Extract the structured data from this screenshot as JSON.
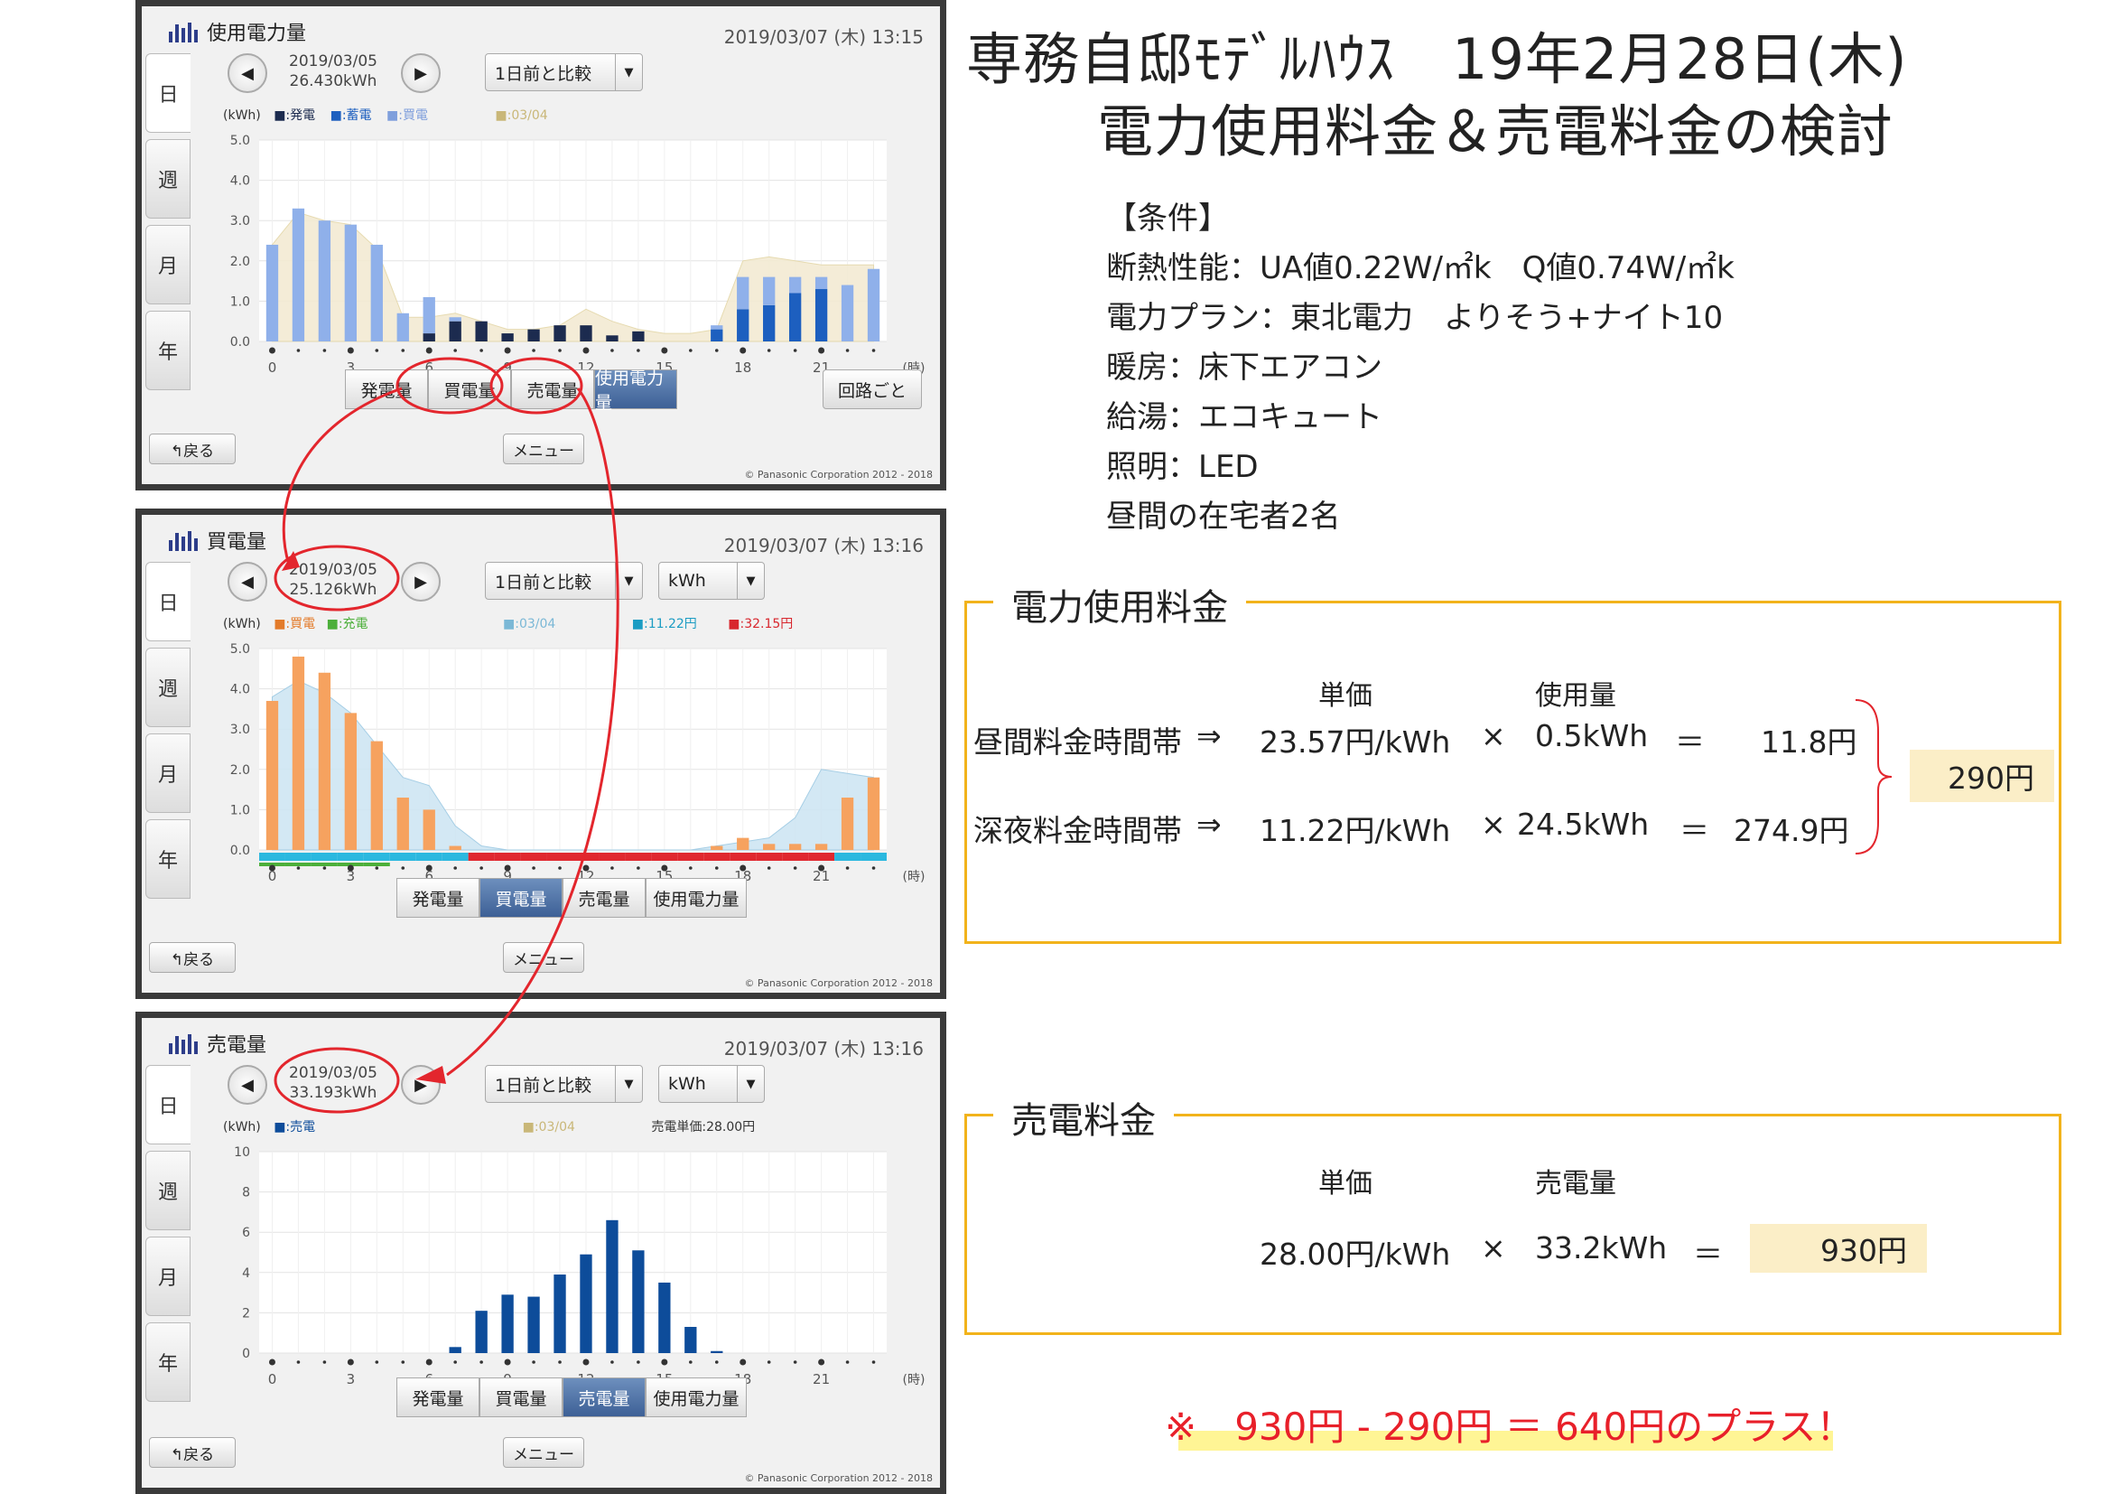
{
  "panels": [
    {
      "title": "使用電力量",
      "timestamp": "2019/03/07 (木) 13:15",
      "date": "2019/03/05",
      "amount": "26.430kWh",
      "compare": "1日前と比較",
      "unit": "",
      "tabs": [
        "日",
        "週",
        "月",
        "年"
      ],
      "legend": [
        "■:発電",
        "■:蓄電",
        "■:買電",
        "■:03/04"
      ],
      "buttons": [
        "発電量",
        "買電量",
        "売電量",
        "使用電力量"
      ],
      "active_button": 3,
      "circuit": "回路ごと",
      "back": "↰戻る",
      "menu": "メニュー",
      "copyright": "© Panasonic Corporation 2012 - 2018"
    },
    {
      "title": "買電量",
      "timestamp": "2019/03/07 (木) 13:16",
      "date": "2019/03/05",
      "amount": "25.126kWh",
      "compare": "1日前と比較",
      "unit": "kWh",
      "tabs": [
        "日",
        "週",
        "月",
        "年"
      ],
      "legend": [
        "■:買電",
        "■:充電",
        "■:03/04",
        "■:11.22円",
        "■:32.15円"
      ],
      "buttons": [
        "発電量",
        "買電量",
        "売電量",
        "使用電力量"
      ],
      "active_button": 1,
      "back": "↰戻る",
      "menu": "メニュー",
      "copyright": "© Panasonic Corporation 2012 - 2018"
    },
    {
      "title": "売電量",
      "timestamp": "2019/03/07 (木) 13:16",
      "date": "2019/03/05",
      "amount": "33.193kWh",
      "compare": "1日前と比較",
      "unit": "kWh",
      "tabs": [
        "日",
        "週",
        "月",
        "年"
      ],
      "legend": [
        "■:売電",
        "■:03/04",
        "売電単価:28.00円"
      ],
      "buttons": [
        "発電量",
        "買電量",
        "売電量",
        "使用電力量"
      ],
      "active_button": 2,
      "back": "↰戻る",
      "menu": "メニュー",
      "copyright": "© Panasonic Corporation 2012 - 2018"
    }
  ],
  "chart_data": [
    {
      "type": "bar",
      "ylabel": "(kWh)",
      "xlabel": "(時)",
      "ylim": [
        0,
        5
      ],
      "yticks": [
        "0.0",
        "1.0",
        "2.0",
        "3.0",
        "4.0",
        "5.0"
      ],
      "xticks": [
        "0",
        "3",
        "6",
        "9",
        "12",
        "15",
        "18",
        "21"
      ],
      "categories": [
        "0",
        "1",
        "2",
        "3",
        "4",
        "5",
        "6",
        "7",
        "8",
        "9",
        "10",
        "11",
        "12",
        "13",
        "14",
        "15",
        "16",
        "17",
        "18",
        "19",
        "20",
        "21",
        "22",
        "23"
      ],
      "series": [
        {
          "name": "発電",
          "color": "#1c2b4f",
          "values": [
            0,
            0,
            0,
            0,
            0,
            0,
            0.2,
            0.5,
            0.5,
            0.2,
            0.3,
            0.4,
            0.4,
            0.15,
            0.25,
            0,
            0,
            0,
            0,
            0,
            0,
            0,
            0,
            0
          ]
        },
        {
          "name": "蓄電",
          "color": "#1d5fbf",
          "values": [
            0,
            0,
            0,
            0,
            0,
            0,
            0,
            0,
            0,
            0,
            0,
            0,
            0,
            0,
            0,
            0,
            0,
            0.3,
            0.8,
            0.9,
            1.2,
            1.3,
            0,
            0
          ]
        },
        {
          "name": "買電",
          "color": "#8fb0ea",
          "values": [
            2.4,
            3.3,
            3.0,
            2.9,
            2.4,
            0.7,
            0.9,
            0.1,
            0,
            0,
            0,
            0,
            0,
            0,
            0,
            0,
            0,
            0.1,
            0.8,
            0.7,
            0.4,
            0.3,
            1.4,
            1.8
          ]
        },
        {
          "name": "03/04",
          "color": "#f3ebd3",
          "values": [
            2.4,
            3.2,
            3.0,
            2.9,
            2.3,
            0.6,
            0.6,
            0.7,
            0.5,
            0.3,
            0.3,
            0.4,
            0.8,
            0.5,
            0.3,
            0.2,
            0.2,
            0.3,
            2.0,
            2.1,
            2.0,
            1.9,
            1.9,
            1.9
          ]
        }
      ]
    },
    {
      "type": "bar",
      "ylabel": "(kWh)",
      "xlabel": "(時)",
      "ylim": [
        0,
        5
      ],
      "yticks": [
        "0.0",
        "1.0",
        "2.0",
        "3.0",
        "4.0",
        "5.0"
      ],
      "xticks": [
        "0",
        "3",
        "6",
        "9",
        "12",
        "15",
        "18",
        "21"
      ],
      "categories": [
        "0",
        "1",
        "2",
        "3",
        "4",
        "5",
        "6",
        "7",
        "8",
        "9",
        "10",
        "11",
        "12",
        "13",
        "14",
        "15",
        "16",
        "17",
        "18",
        "19",
        "20",
        "21",
        "22",
        "23"
      ],
      "series": [
        {
          "name": "買電",
          "color": "#f6a25f",
          "values": [
            3.7,
            4.8,
            4.4,
            3.4,
            2.7,
            1.3,
            1.0,
            0.1,
            0,
            0,
            0,
            0,
            0,
            0,
            0,
            0,
            0,
            0.1,
            0.3,
            0.15,
            0.15,
            0.15,
            1.3,
            1.8
          ]
        },
        {
          "name": "03/04",
          "color": "#cfe6f3",
          "values": [
            3.8,
            4.2,
            3.9,
            3.4,
            2.6,
            1.8,
            1.6,
            0.6,
            0.1,
            0,
            0,
            0,
            0,
            0,
            0,
            0,
            0,
            0.1,
            0.2,
            0.3,
            0.8,
            2.0,
            1.9,
            1.8
          ]
        }
      ],
      "price_band": [
        "#2bb8df",
        "#2bb8df",
        "#2bb8df",
        "#2bb8df",
        "#2bb8df",
        "#2bb8df",
        "#2bb8df",
        "#2bb8df",
        "#e0282f",
        "#e0282f",
        "#e0282f",
        "#e0282f",
        "#e0282f",
        "#e0282f",
        "#e0282f",
        "#e0282f",
        "#e0282f",
        "#e0282f",
        "#e0282f",
        "#e0282f",
        "#e0282f",
        "#e0282f",
        "#2bb8df",
        "#2bb8df"
      ]
    },
    {
      "type": "bar",
      "ylabel": "(kWh)",
      "xlabel": "(時)",
      "ylim": [
        0,
        10
      ],
      "yticks": [
        "0",
        "2",
        "4",
        "6",
        "8",
        "10"
      ],
      "xticks": [
        "0",
        "3",
        "6",
        "9",
        "12",
        "15",
        "18",
        "21"
      ],
      "categories": [
        "0",
        "1",
        "2",
        "3",
        "4",
        "5",
        "6",
        "7",
        "8",
        "9",
        "10",
        "11",
        "12",
        "13",
        "14",
        "15",
        "16",
        "17",
        "18",
        "19",
        "20",
        "21",
        "22",
        "23"
      ],
      "series": [
        {
          "name": "売電",
          "color": "#0d4c9a",
          "values": [
            0,
            0,
            0,
            0,
            0,
            0,
            0,
            0.3,
            2.1,
            2.9,
            2.8,
            3.9,
            4.9,
            6.6,
            5.1,
            3.5,
            1.3,
            0.1,
            0,
            0,
            0,
            0,
            0,
            0
          ]
        }
      ]
    }
  ],
  "main": {
    "title_line1": "専務自邸ﾓﾃﾞﾙﾊｳｽ　19年2月28日(木)",
    "title_line2": "電力使用料金＆売電料金の検討",
    "conditions_heading": "【条件】",
    "conditions": [
      "断熱性能：UA値0.22W/㎡k　Q値0.74W/㎡k",
      "電力プラン：東北電力　よりそう+ナイト10",
      "暖房：床下エアコン",
      "給湯：エコキュート",
      "照明：LED",
      "昼間の在宅者2名"
    ]
  },
  "usage_box": {
    "title": "電力使用料金",
    "col_unit_price": "単価",
    "col_usage": "使用量",
    "rows": [
      {
        "label": "昼間料金時間帯",
        "arrow": "⇒",
        "price": "23.57円/kWh",
        "times": "×",
        "qty": "0.5kWh",
        "eq": "＝",
        "result": "11.8円"
      },
      {
        "label": "深夜料金時間帯",
        "arrow": "⇒",
        "price": "11.22円/kWh",
        "times": "×",
        "qty": "24.5kWh",
        "eq": "＝",
        "result": "274.9円"
      }
    ],
    "total": "290円"
  },
  "sell_box": {
    "title": "売電料金",
    "col_unit_price": "単価",
    "col_amount": "売電量",
    "price": "28.00円/kWh",
    "times": "×",
    "qty": "33.2kWh",
    "eq": "＝",
    "result": "930円"
  },
  "note": "※　930円 - 290円 ＝ 640円のプラス！"
}
